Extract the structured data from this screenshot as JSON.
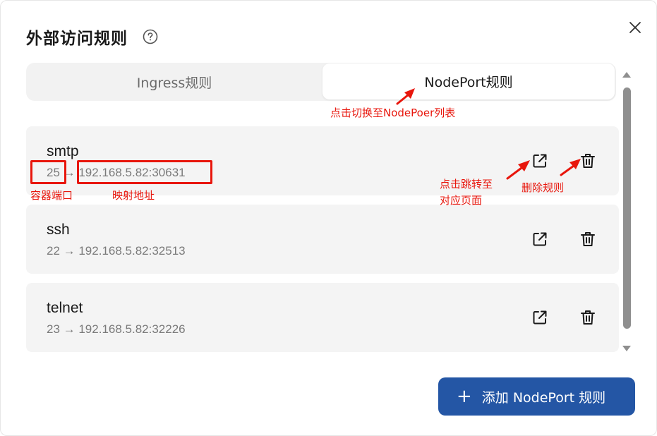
{
  "dialog": {
    "title": "外部访问规则",
    "help_icon": "help-circle-icon",
    "close_icon": "close-icon"
  },
  "tabs": [
    {
      "label": "Ingress规则",
      "active": false
    },
    {
      "label": "NodePort规则",
      "active": true
    }
  ],
  "rules": [
    {
      "name": "smtp",
      "mapping": "25 → 192.168.5.82:30631"
    },
    {
      "name": "ssh",
      "mapping": "22 → 192.168.5.82:32513"
    },
    {
      "name": "telnet",
      "mapping": "23 → 192.168.5.82:32226"
    }
  ],
  "icons": {
    "open": "external-link-icon",
    "delete": "trash-icon"
  },
  "add_button": {
    "icon": "plus-icon",
    "label": "添加 NodePort 规则"
  },
  "annotations": {
    "tab_hint": "点击切换至NodePoer列表",
    "container_port": "容器端口",
    "mapped_address": "映射地址",
    "jump_line1": "点击跳转至",
    "jump_line2": "对应页面",
    "delete_rule": "删除规则"
  },
  "colors": {
    "primary": "#2456a5",
    "annotation": "#e8160c",
    "card_bg": "#f4f4f4"
  }
}
